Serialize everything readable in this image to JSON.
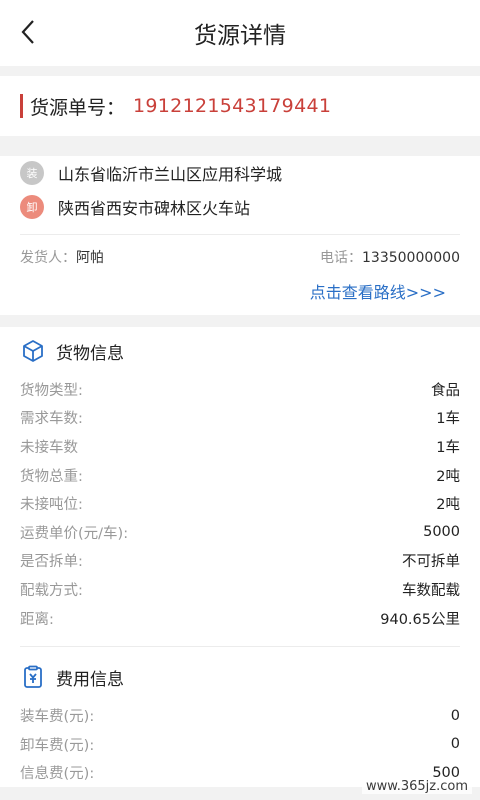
{
  "header": {
    "title": "货源详情"
  },
  "order": {
    "label": "货源单号：",
    "number": "1912121543179441"
  },
  "route": {
    "load_badge": "装",
    "load_address": "山东省临沂市兰山区应用科学城",
    "unload_badge": "卸",
    "unload_address": "陕西省西安市碑林区火车站",
    "shipper_label": "发货人：",
    "shipper_name": "阿帕",
    "phone_label": "电话：",
    "phone": "13350000000",
    "view_route": "点击查看路线>>>"
  },
  "cargo": {
    "title": "货物信息",
    "rows": [
      {
        "label": "货物类型:",
        "value": "食品"
      },
      {
        "label": "需求车数:",
        "value": "1车"
      },
      {
        "label": "未接车数",
        "value": "1车"
      },
      {
        "label": "货物总重:",
        "value": "2吨"
      },
      {
        "label": "未接吨位:",
        "value": "2吨"
      },
      {
        "label": "运费单价(元/车):",
        "value": "5000"
      },
      {
        "label": "是否拆单:",
        "value": "不可拆单"
      },
      {
        "label": "配载方式:",
        "value": "车数配载"
      },
      {
        "label": "距离:",
        "value": "940.65公里"
      }
    ]
  },
  "fees": {
    "title": "费用信息",
    "rows": [
      {
        "label": "装车费(元):",
        "value": "0"
      },
      {
        "label": "卸车费(元):",
        "value": "0"
      },
      {
        "label": "信息费(元):",
        "value": "500"
      }
    ]
  },
  "watermark": "www.365jz.com",
  "colors": {
    "accent_red": "#c9403a",
    "link_blue": "#2a6fc6",
    "icon_blue": "#2a6fc6"
  }
}
